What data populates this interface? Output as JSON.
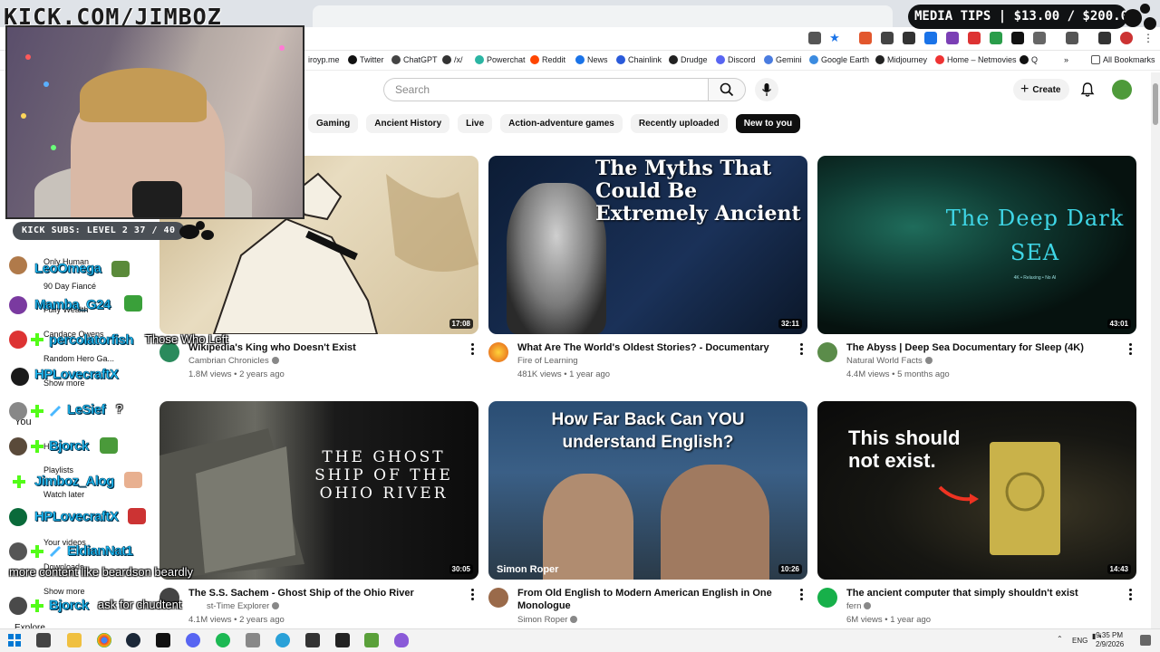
{
  "overlay": {
    "kick_url": "KICK.COM/JIMBOZ",
    "media_tips": "MEDIA TIPS | $13.00 / $200.00",
    "kick_subs": "KICK SUBS: LEVEL 2 37 / 40"
  },
  "bookmarks": [
    {
      "label": "iroyp.me",
      "color": "#555"
    },
    {
      "label": "Twitter",
      "color": "#111"
    },
    {
      "label": "ChatGPT",
      "color": "#444"
    },
    {
      "label": "/x/",
      "color": "#333"
    },
    {
      "label": "Powerchat",
      "color": "#2bb5a3"
    },
    {
      "label": "Reddit",
      "color": "#ff4500"
    },
    {
      "label": "News",
      "color": "#1a73e8"
    },
    {
      "label": "Chainlink",
      "color": "#2a5ada"
    },
    {
      "label": "Drudge",
      "color": "#222"
    },
    {
      "label": "Discord",
      "color": "#5865f2"
    },
    {
      "label": "Gemini",
      "color": "#4a7ce0"
    },
    {
      "label": "Google Earth",
      "color": "#3b8be0"
    },
    {
      "label": "Midjourney",
      "color": "#222"
    },
    {
      "label": "Home – Netmovies",
      "color": "#e33"
    },
    {
      "label": "Q",
      "color": "#111"
    }
  ],
  "all_bookmarks": "All Bookmarks",
  "search": {
    "placeholder": "Search"
  },
  "header": {
    "create": "Create"
  },
  "chips": [
    "Gaming",
    "Ancient History",
    "Live",
    "Action-adventure games",
    "Recently uploaded",
    "New to you"
  ],
  "videos": [
    {
      "title": "Wikipedia's King who Doesn't Exist",
      "channel": "Cambrian Chronicles",
      "meta": "1.8M views • 2 years ago",
      "duration": "17:08",
      "thumb_text": ""
    },
    {
      "title": "What Are The World's Oldest Stories? - Documentary",
      "channel": "Fire of Learning",
      "meta": "481K views • 1 year ago",
      "duration": "32:11",
      "thumb_text": "The Myths That Could Be Extremely Ancient"
    },
    {
      "title": "The Abyss | Deep Sea Documentary for Sleep (4K)",
      "channel": "Natural World Facts",
      "meta": "4.4M views • 5 months ago",
      "duration": "43:01",
      "thumb_text": "The Deep Dark SEA",
      "thumb_sub": "4K • Relaxing • No AI"
    },
    {
      "title": "The S.S. Sachem - Ghost Ship of the Ohio River",
      "channel": "st-Time Explorer",
      "meta": "4.1M views • 2 years ago",
      "duration": "30:05",
      "thumb_text": "THE GHOST SHIP OF THE OHIO RIVER"
    },
    {
      "title": "From Old English to Modern American English in One Monologue",
      "channel": "Simon Roper",
      "meta": "",
      "duration": "10:26",
      "thumb_text": "How Far Back Can YOU understand English?",
      "thumb_sub": "Simon Roper"
    },
    {
      "title": "The ancient computer that simply shouldn't exist",
      "channel": "fern",
      "meta": "6M views • 1 year ago",
      "duration": "14:43",
      "thumb_text": "This should not exist."
    }
  ],
  "sidebar": {
    "items": [
      "Only Human",
      "90 Day Fiancé",
      "Fully Wealth",
      "Candace Owens",
      "Random Hero Ga...",
      "Show more",
      "You",
      "H",
      "Playlists",
      "Watch later",
      "Your videos",
      "Downloads",
      "Show more",
      "Explore"
    ]
  },
  "chat": [
    {
      "name": "LeoOmega",
      "msg": ""
    },
    {
      "name": "Mamba_G24",
      "msg": ""
    },
    {
      "name": "percolatorfish",
      "msg": "Those Who Left"
    },
    {
      "name": "HPLovecraftX",
      "msg": ""
    },
    {
      "name": "LeSief",
      "msg": "?"
    },
    {
      "name": "Bjorck",
      "msg": ""
    },
    {
      "name": "Jimboz_Alog",
      "msg": ""
    },
    {
      "name": "HPLovecraftX",
      "msg": ""
    },
    {
      "name": "EldianNat1",
      "msg": "more content like beardson beardly"
    },
    {
      "name": "Bjorck",
      "msg": "ask for chudtent"
    }
  ],
  "taskbar": {
    "lang": "ENG",
    "time": "9:35 PM",
    "date": "2/9/2026"
  }
}
